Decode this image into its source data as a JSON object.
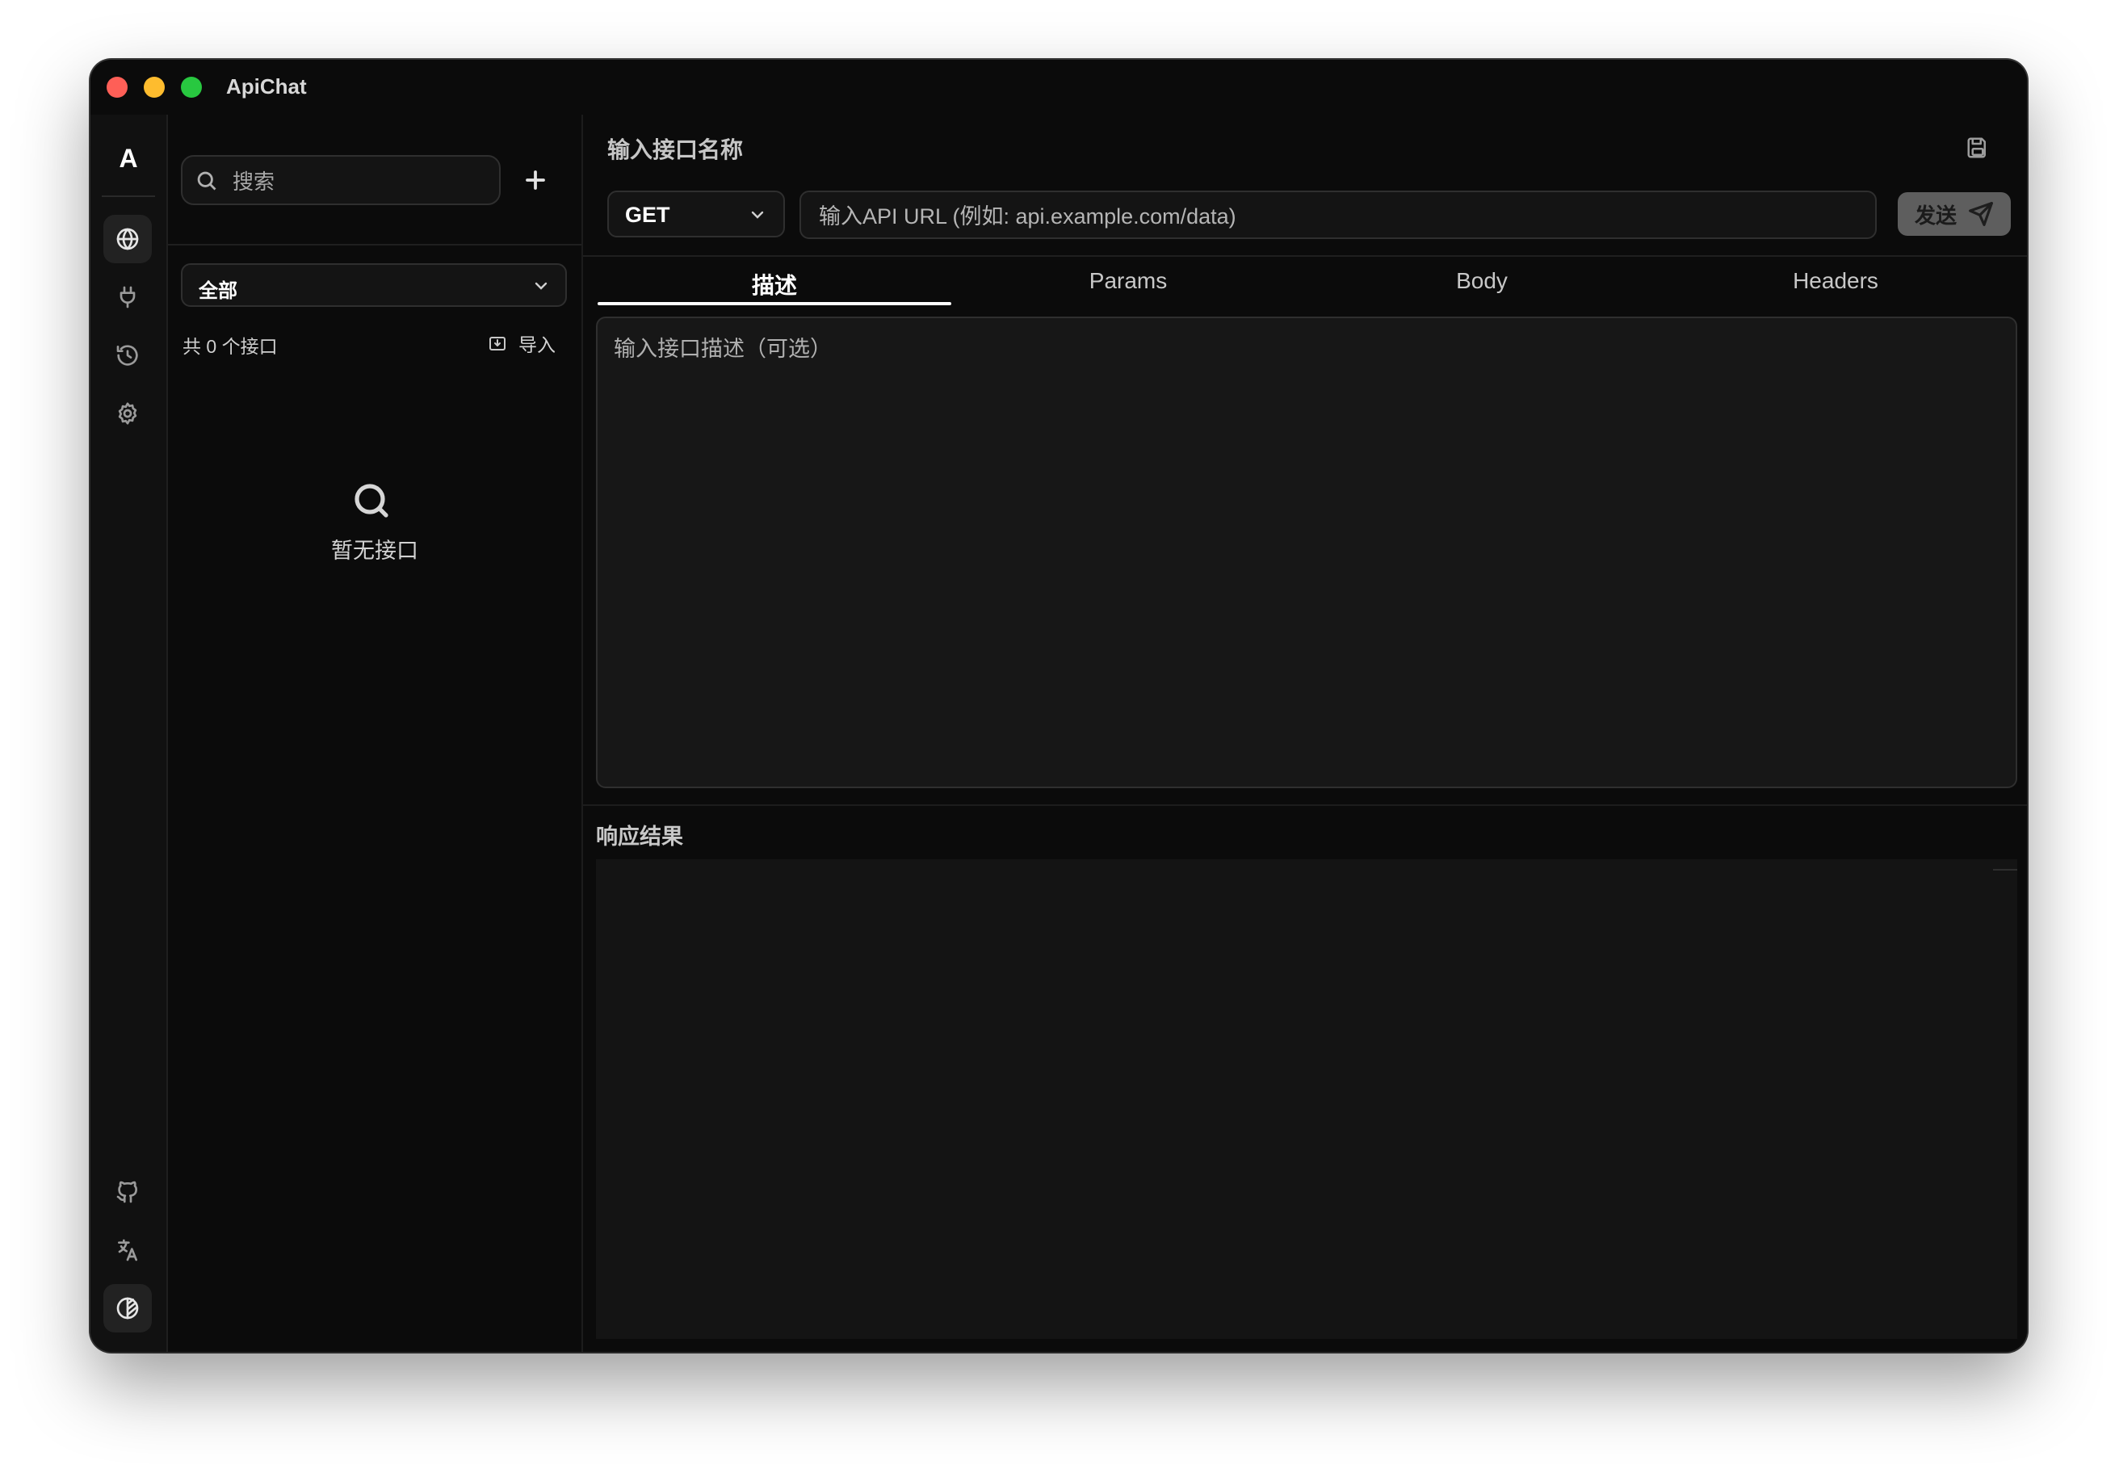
{
  "app": {
    "title": "ApiChat",
    "logo_letter": "A"
  },
  "rail": {
    "top_icons": [
      {
        "name": "globe-icon",
        "active": true
      },
      {
        "name": "plug-icon",
        "active": false
      },
      {
        "name": "history-icon",
        "active": false
      },
      {
        "name": "settings-icon",
        "active": false
      }
    ],
    "bottom_icons": [
      "github-icon",
      "translate-icon",
      "theme-toggle-icon"
    ]
  },
  "list": {
    "search_placeholder": "搜索",
    "filter_value": "全部",
    "count_label": "共 0 个接口",
    "import_label": "导入",
    "empty_text": "暂无接口"
  },
  "request": {
    "name_placeholder": "输入接口名称",
    "method": "GET",
    "url_placeholder": "输入API URL (例如: api.example.com/data)",
    "send_label": "发送",
    "tabs": [
      {
        "label": "描述",
        "active": true
      },
      {
        "label": "Params",
        "active": false
      },
      {
        "label": "Body",
        "active": false
      },
      {
        "label": "Headers",
        "active": false
      }
    ],
    "description_placeholder": "输入接口描述（可选）"
  },
  "response": {
    "label": "响应结果"
  }
}
